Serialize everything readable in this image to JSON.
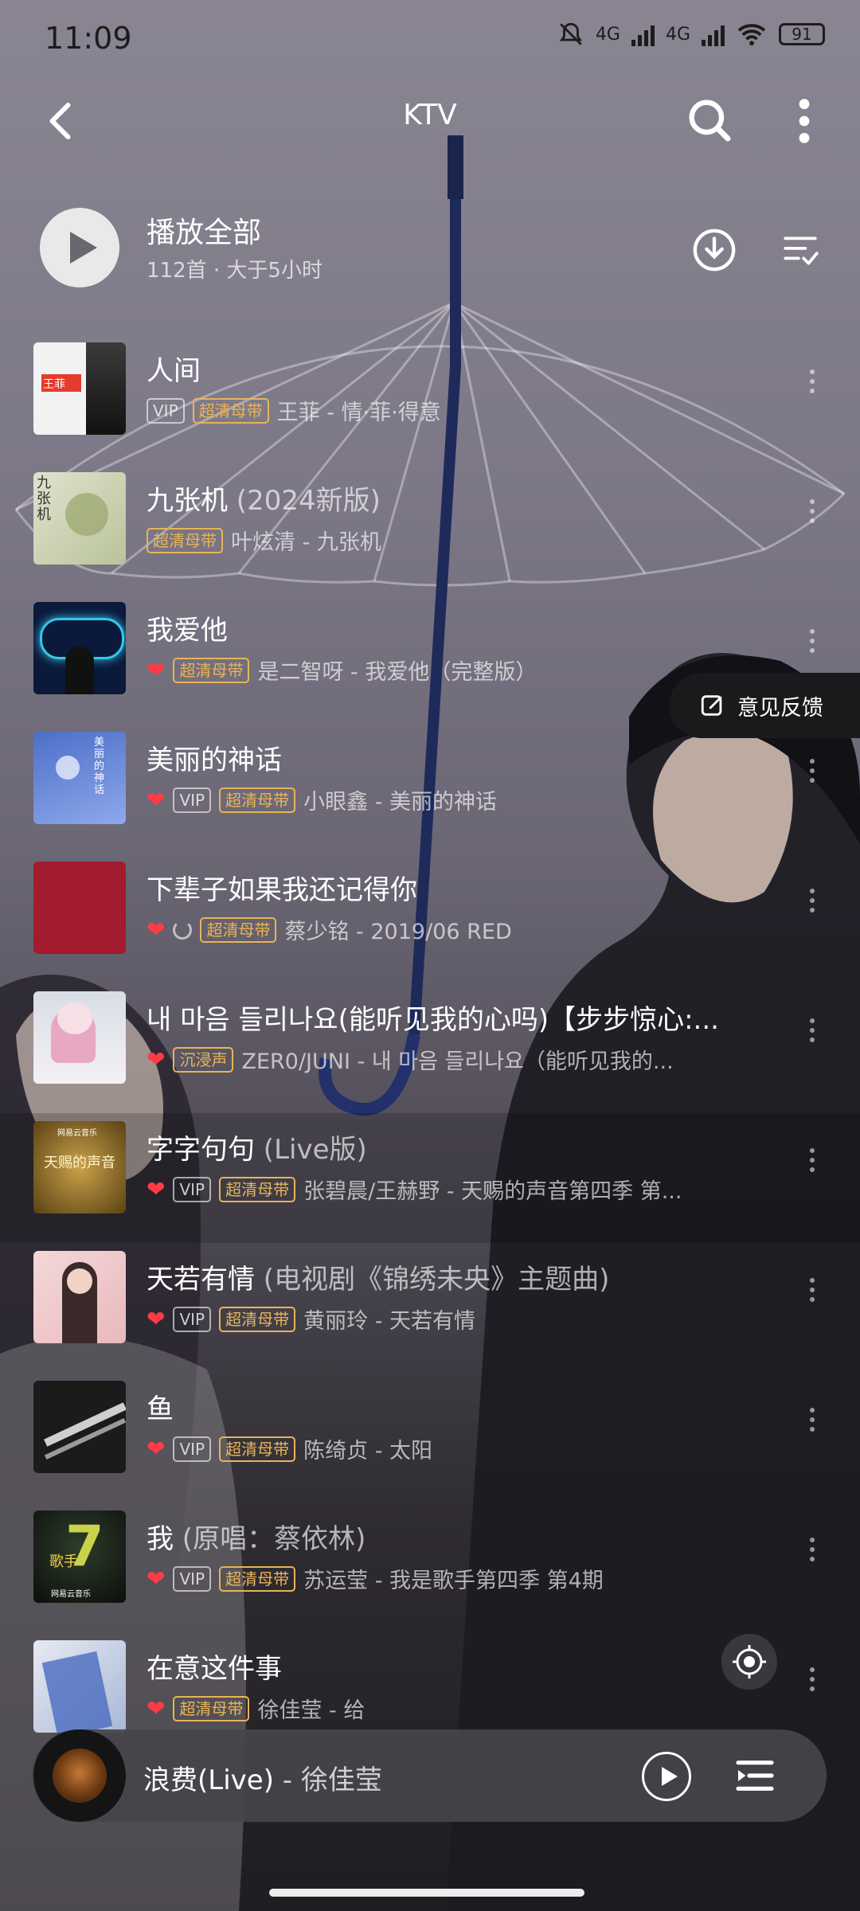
{
  "status_bar": {
    "time": "11:09",
    "net1": "4G",
    "net2": "4G",
    "battery": "91"
  },
  "nav": {
    "title": "KTV"
  },
  "play_all": {
    "title": "播放全部",
    "subtitle": "112首 · 大于5小时"
  },
  "songs": [
    {
      "title": "人间",
      "title_suffix": "",
      "liked": false,
      "vip": true,
      "quality": "超清母带",
      "meta": "王菲 - 情·菲·得意"
    },
    {
      "title": "九张机",
      "title_suffix": " (2024新版)",
      "liked": false,
      "vip": false,
      "quality": "超清母带",
      "meta": "叶炫清 - 九张机"
    },
    {
      "title": "我爱他",
      "title_suffix": "",
      "liked": true,
      "vip": false,
      "quality": "超清母带",
      "meta": "是二智呀 - 我爱他（完整版）"
    },
    {
      "title": "美丽的神话",
      "title_suffix": "",
      "liked": true,
      "vip": true,
      "quality": "超清母带",
      "meta": "小眼鑫 - 美丽的神话"
    },
    {
      "title": "下辈子如果我还记得你",
      "title_suffix": "",
      "liked": true,
      "vip": false,
      "quality": "超清母带",
      "meta": "蔡少铭 - 2019/06 RED"
    },
    {
      "title": "내 마음 들리나요(能听见我的心吗)【步步惊心:...",
      "title_suffix": "",
      "liked": true,
      "vip": false,
      "quality": "沉浸声",
      "meta": "ZER0/JUNI - 내 마음 들리나요（能听见我的..."
    },
    {
      "title": "字字句句",
      "title_suffix": " (Live版)",
      "liked": true,
      "vip": true,
      "quality": "超清母带",
      "meta": "张碧晨/王赫野 - 天赐的声音第四季 第..."
    },
    {
      "title": "天若有情",
      "title_suffix": " (电视剧《锦绣未央》主题曲)",
      "liked": true,
      "vip": true,
      "quality": "超清母带",
      "meta": "黄丽玲 - 天若有情"
    },
    {
      "title": "鱼",
      "title_suffix": "",
      "liked": true,
      "vip": true,
      "quality": "超清母带",
      "meta": "陈绮贞 - 太阳"
    },
    {
      "title": "我",
      "title_suffix": " (原唱：蔡依林)",
      "liked": true,
      "vip": true,
      "quality": "超清母带",
      "meta": "苏运莹 - 我是歌手第四季 第4期"
    },
    {
      "title": "在意这件事",
      "title_suffix": "",
      "liked": true,
      "vip": false,
      "quality": "超清母带",
      "meta": "徐佳莹 - 给"
    }
  ],
  "badges": {
    "vip": "VIP"
  },
  "covers": {
    "c0": "王菲",
    "c1": "九张机",
    "c3": "美丽的神话",
    "c6": "天赐的声音",
    "c9": "歌手",
    "c9b": "网易云音乐",
    "c6b": "网易云音乐"
  },
  "feedback": {
    "label": "意见反馈"
  },
  "now_playing": {
    "title": "浪费(Live)",
    "artist": " - 徐佳莹"
  }
}
